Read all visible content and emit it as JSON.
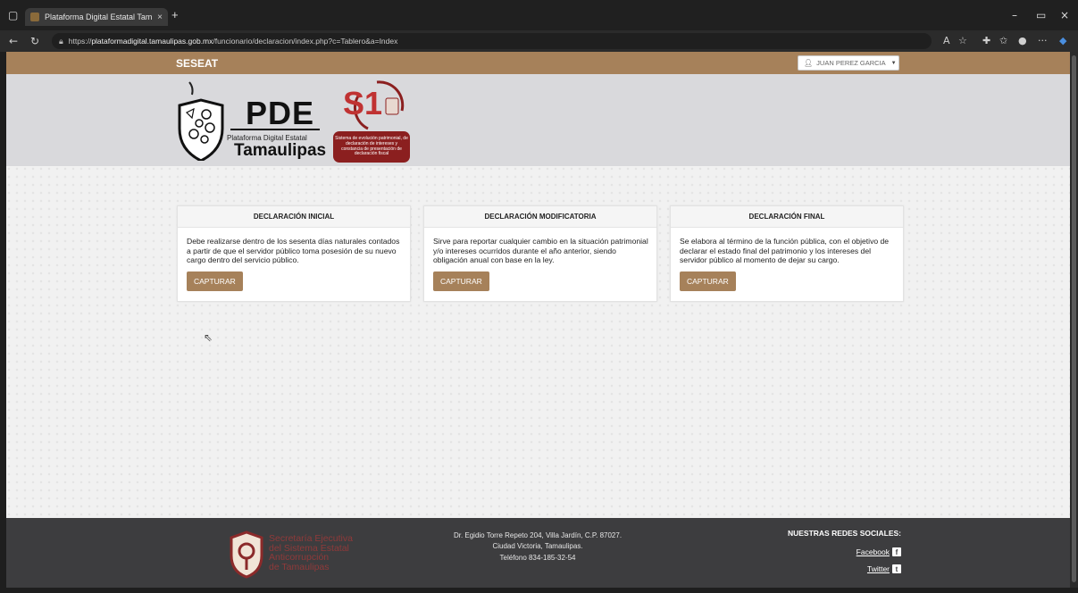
{
  "browser": {
    "tab_title": "Plataforma Digital Estatal Tamauli...",
    "tab_close": "×",
    "new_tab": "+",
    "url_prefix": "https://",
    "url_host": "plataformadigital.tamaulipas.gob.mx",
    "url_path": "/funcionario/declaracion/index.php?c=Tablero&a=Index",
    "minimize": "–",
    "restore": "▭",
    "close": "×"
  },
  "navbar": {
    "brand": "SESEAT",
    "user_name": "JUAN PEREZ GARCIA"
  },
  "header": {
    "pde_title": "PDE",
    "pde_subtitle": "Plataforma Digital Estatal",
    "pde_state": "Tamaulipas",
    "s1_title": "S1",
    "s1_badge": "Sistema de evolución patrimonial, de declaración de intereses y constancia de presentación de declaración fiscal"
  },
  "cards": [
    {
      "title": "DECLARACIÓN INICIAL",
      "text": "Debe realizarse dentro de los sesenta días naturales contados a partir de que el servidor público toma posesión de su nuevo cargo dentro del servicio público.",
      "button": "CAPTURAR"
    },
    {
      "title": "DECLARACIÓN MODIFICATORIA",
      "text": "Sirve para reportar cualquier cambio en la situación patrimonial y/o intereses ocurridos durante el año anterior, siendo obligación anual con base en la ley.",
      "button": "CAPTURAR"
    },
    {
      "title": "DECLARACIÓN FINAL",
      "text": "Se elabora al término de la función pública, con el objetivo de declarar el estado final del patrimonio y los intereses del servidor público al momento de dejar su cargo.",
      "button": "CAPTURAR"
    }
  ],
  "footer": {
    "logo_lines": [
      "Secretaría Ejecutiva",
      "del Sistema Estatal",
      "Anticorrupción",
      "de Tamaulipas"
    ],
    "address_line1": "Dr. Egidio Torre Repeto 204, Villa Jardín, C.P. 87027.",
    "address_line2": "Ciudad Victoria, Tamaulipas.",
    "address_line3": "Teléfono 834-185-32-54",
    "social_title": "NUESTRAS REDES SOCIALES:",
    "facebook": "Facebook",
    "twitter": "Twitter"
  },
  "colors": {
    "accent": "#a6815a",
    "footer_bg": "#3d3d3f",
    "s1_red": "#8b1f1f"
  }
}
